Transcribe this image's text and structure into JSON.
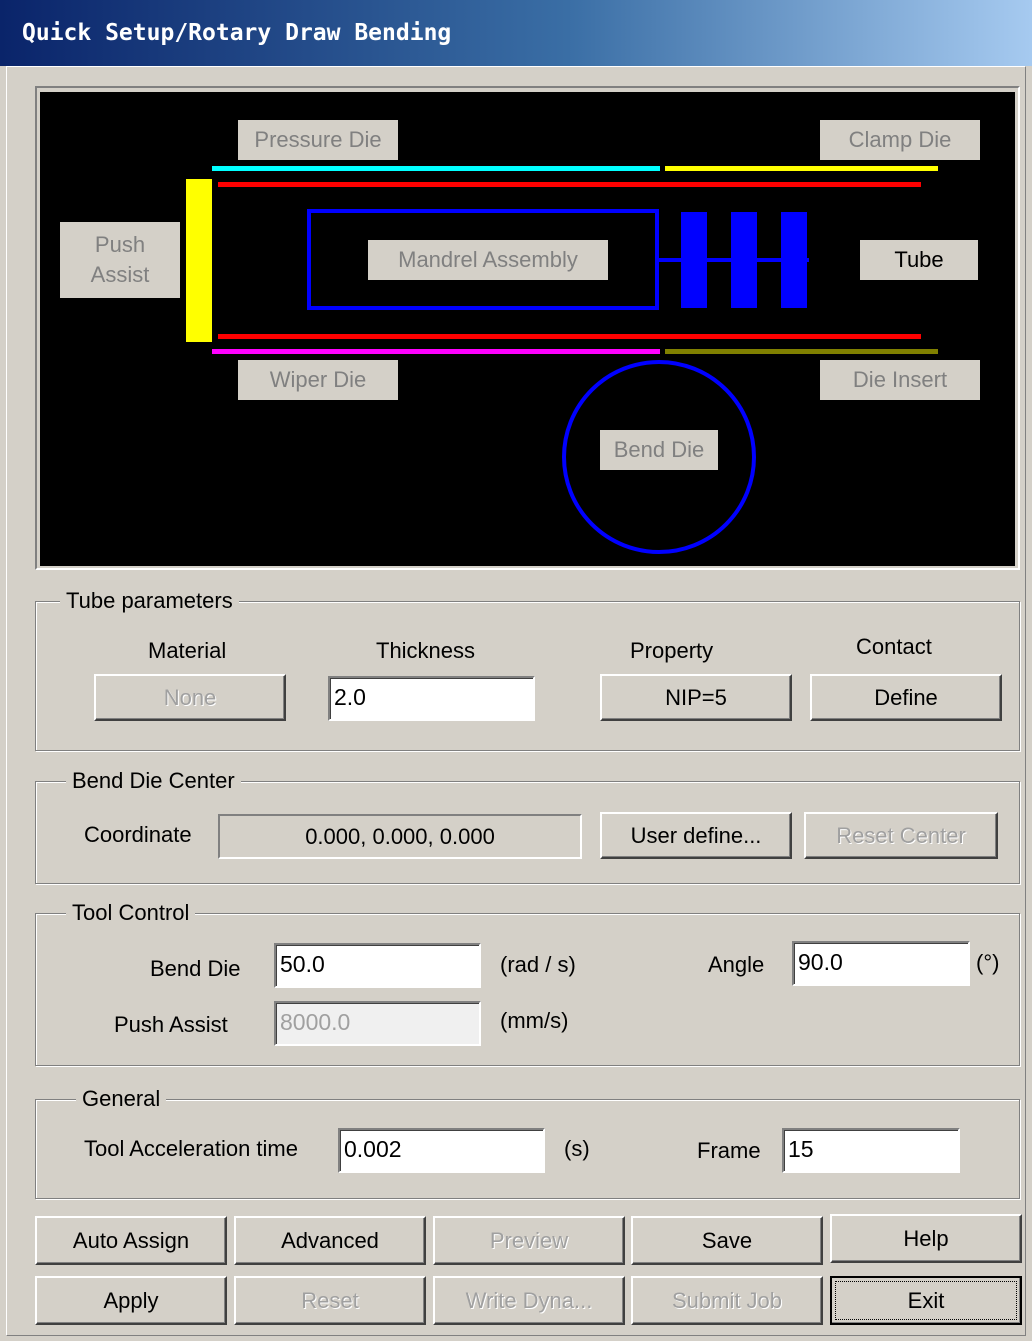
{
  "window": {
    "title": "Quick Setup/Rotary Draw Bending"
  },
  "diagram": {
    "pressure_die": "Pressure Die",
    "clamp_die": "Clamp Die",
    "push_assist": "Push Assist",
    "mandrel_assembly": "Mandrel Assembly",
    "tube": "Tube",
    "wiper_die": "Wiper Die",
    "die_insert": "Die Insert",
    "bend_die": "Bend Die",
    "colors": {
      "background": "#000000",
      "pressure_die": "#00ffff",
      "clamp_die": "#ffff00",
      "tube": "#ff0000",
      "push_assist": "#ffff00",
      "mandrel": "#0000ff",
      "wiper_die": "#ff00ff",
      "die_insert": "#808000",
      "bend_die": "#0000ff"
    }
  },
  "tube_parameters": {
    "legend": "Tube parameters",
    "material_label": "Material",
    "thickness_label": "Thickness",
    "property_label": "Property",
    "contact_label": "Contact",
    "material_button": "None",
    "thickness_value": "2.0",
    "property_button": "NIP=5",
    "contact_button": "Define"
  },
  "bend_die_center": {
    "legend": "Bend Die Center",
    "coordinate_label": "Coordinate",
    "coordinate_value": "0.000,  0.000,  0.000",
    "user_define_button": "User define...",
    "reset_center_button": "Reset Center"
  },
  "tool_control": {
    "legend": "Tool Control",
    "bend_die_label": "Bend Die",
    "bend_die_value": "50.0",
    "bend_die_unit": "(rad / s)",
    "angle_label": "Angle",
    "angle_value": "90.0",
    "angle_unit": "(°)",
    "push_assist_label": "Push Assist",
    "push_assist_value": "8000.0",
    "push_assist_unit": "(mm/s)"
  },
  "general": {
    "legend": "General",
    "accel_label": "Tool Acceleration time",
    "accel_value": "0.002",
    "accel_unit": "(s)",
    "frame_label": "Frame",
    "frame_value": "15"
  },
  "buttons": {
    "auto_assign": "Auto Assign",
    "advanced": "Advanced",
    "preview": "Preview",
    "save": "Save",
    "help": "Help",
    "apply": "Apply",
    "reset": "Reset",
    "write_dyna": "Write Dyna...",
    "submit_job": "Submit Job",
    "exit": "Exit"
  }
}
